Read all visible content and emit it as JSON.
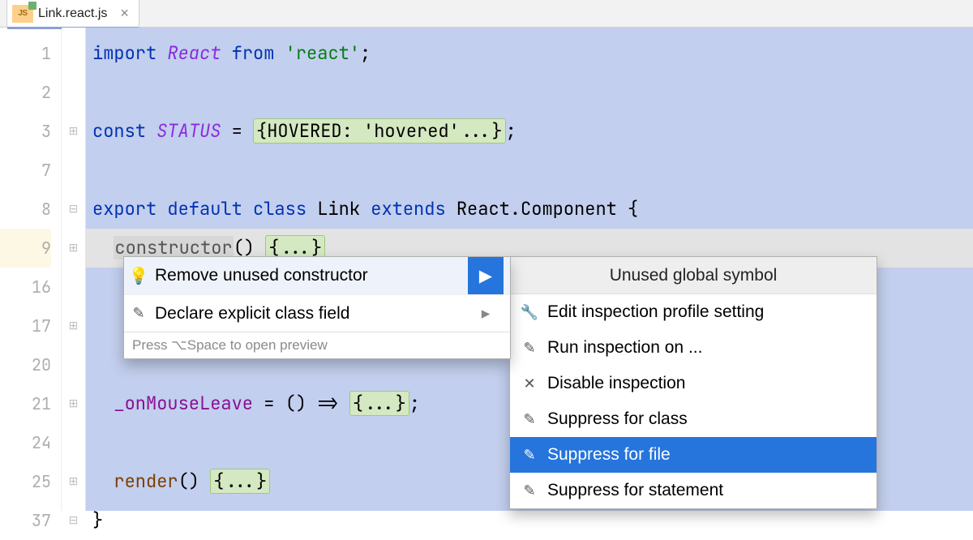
{
  "tab": {
    "badge": "JS",
    "filename": "Link.react.js"
  },
  "gutter": [
    "1",
    "2",
    "3",
    "7",
    "8",
    "9",
    "16",
    "17",
    "20",
    "21",
    "24",
    "25",
    "37"
  ],
  "code": {
    "l1_import": "import",
    "l1_react": "React",
    "l1_from": "from",
    "l1_str": "'react'",
    "l3_const": "const",
    "l3_status": "STATUS",
    "l3_eq": " = ",
    "l3_fold": "{HOVERED: 'hovered'...}",
    "l8_export": "export",
    "l8_default": "default",
    "l8_class": "class",
    "l8_link": "Link",
    "l8_extends": "extends",
    "l8_rc": "React.Component {",
    "l9_ctor": "constructor",
    "l9_par": "()",
    "l9_fold": "{...}",
    "l17": "  ",
    "l21_field": "_onMouseLeave",
    "l21_arrow": " = () => ",
    "l21_fold": "{...}",
    "l25_render": "render",
    "l25_par": "()",
    "l25_fold": "{...}",
    "l37": "}"
  },
  "popup1": {
    "items": [
      {
        "icon": "bulb",
        "label": "Remove unused constructor",
        "arrow": true,
        "sel": true
      },
      {
        "icon": "wand",
        "label": "Declare explicit class field",
        "arrow": true,
        "sel": false
      }
    ],
    "footer": "Press ⌥Space to open preview"
  },
  "popup2": {
    "header": "Unused global symbol",
    "items": [
      {
        "icon": "wrench",
        "label": "Edit inspection profile setting"
      },
      {
        "icon": "wand",
        "label": "Run inspection on ..."
      },
      {
        "icon": "x",
        "label": "Disable inspection"
      },
      {
        "icon": "wand",
        "label": "Suppress for class"
      },
      {
        "icon": "wand",
        "label": "Suppress for file",
        "sel": true
      },
      {
        "icon": "wand",
        "label": "Suppress for statement"
      }
    ]
  }
}
